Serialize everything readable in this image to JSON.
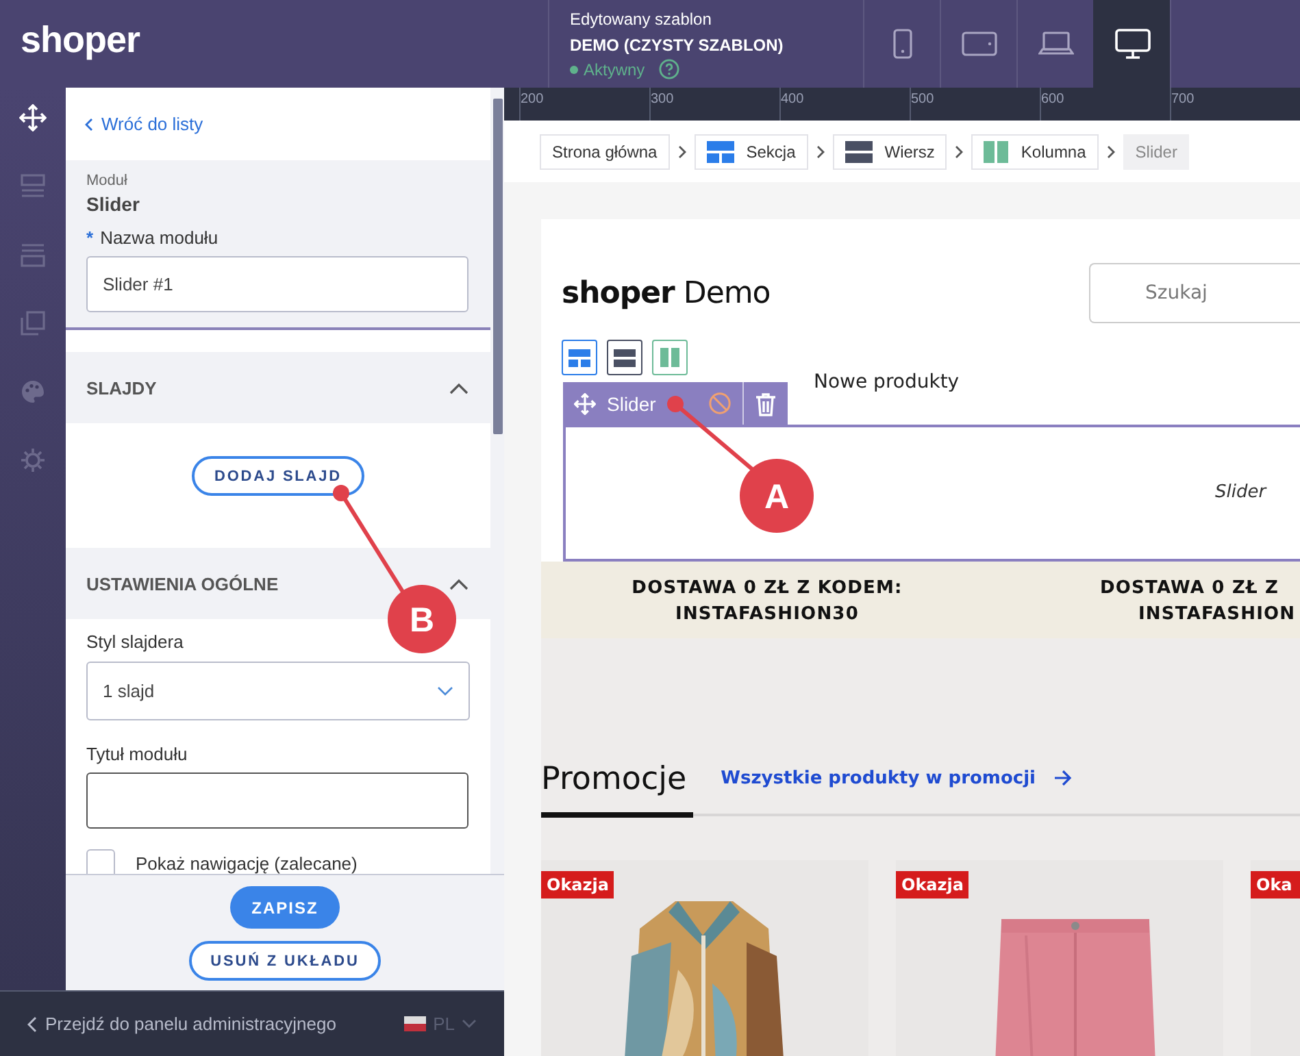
{
  "topbar": {
    "logo": "shoper",
    "template_label": "Edytowany szablon",
    "template_name": "DEMO (CZYSTY SZABLON)",
    "status": "Aktywny",
    "devices": [
      {
        "kind": "phone",
        "selected": false
      },
      {
        "kind": "tablet",
        "selected": false
      },
      {
        "kind": "laptop",
        "selected": false
      },
      {
        "kind": "desktop",
        "selected": true
      }
    ]
  },
  "rail": [
    {
      "kind": "move",
      "selected": true
    },
    {
      "kind": "layout",
      "selected": false
    },
    {
      "kind": "rows",
      "selected": false
    },
    {
      "kind": "pages",
      "selected": false
    },
    {
      "kind": "palette",
      "selected": false
    },
    {
      "kind": "settings",
      "selected": false
    }
  ],
  "panel": {
    "back": "Wróć do listy",
    "module_caption": "Moduł",
    "module_name": "Slider",
    "required_mark": "*",
    "name_label": "Nazwa modułu",
    "name_value": "Slider #1",
    "sections": [
      {
        "title": "SLAJDY",
        "expanded": true
      },
      {
        "title": "USTAWIENIA OGÓLNE",
        "expanded": true
      }
    ],
    "add_slide": "DODAJ SLAJD",
    "style_label": "Styl slajdera",
    "style_value": "1 slajd",
    "title_label": "Tytuł modułu",
    "nav_checkbox": {
      "label": "Pokaż nawigację (zalecane)",
      "checked": false
    },
    "save": "ZAPISZ",
    "remove": "USUŃ Z UKŁADU"
  },
  "bottom_bar": {
    "link": "Przejdź do panelu administracyjnego",
    "language": "PL"
  },
  "ruler": [
    "200",
    "300",
    "400",
    "500",
    "600",
    "700"
  ],
  "breadcrumb": [
    {
      "label": "Strona główna",
      "kind": "page"
    },
    {
      "label": "Sekcja",
      "kind": "section"
    },
    {
      "label": "Wiersz",
      "kind": "row"
    },
    {
      "label": "Kolumna",
      "kind": "column"
    },
    {
      "label": "Slider",
      "kind": "current"
    }
  ],
  "preview": {
    "logo_bold": "shoper",
    "logo_rest": "Demo",
    "search_placeholder": "Szukaj",
    "builder_tools": [
      {
        "kind": "section"
      },
      {
        "kind": "row"
      },
      {
        "kind": "column"
      }
    ],
    "nav": [
      "Nowe produkty"
    ],
    "module_label": "Slider",
    "slider_placeholder": "Slider",
    "banners": [
      {
        "lines": [
          "DOSTAWA 0 ZŁ Z KODEM:",
          "INSTAFASHION30"
        ]
      },
      {
        "lines": [
          "DOSTAWA 0 ZŁ Z",
          "INSTAFASHION"
        ]
      }
    ],
    "promo_title": "Promocje",
    "promo_link": "Wszystkie produkty w promocji",
    "products": [
      {
        "badge": "Okazja",
        "kind": "shirt"
      },
      {
        "badge": "Okazja",
        "kind": "pants"
      },
      {
        "badge": "Oka",
        "kind": "hidden"
      }
    ]
  },
  "annotations": [
    {
      "label": "A"
    },
    {
      "label": "B"
    }
  ]
}
